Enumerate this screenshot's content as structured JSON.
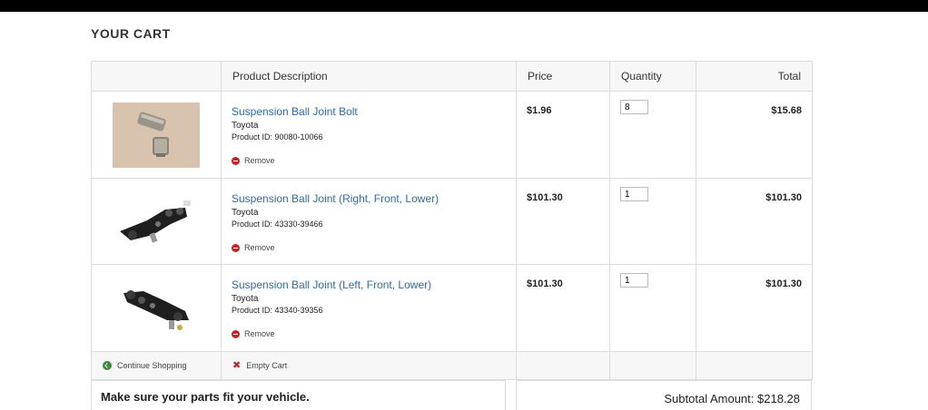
{
  "cart": {
    "title": "YOUR CART",
    "headers": {
      "description": "Product Description",
      "price": "Price",
      "quantity": "Quantity",
      "total": "Total"
    },
    "items": [
      {
        "name": "Suspension Ball Joint Bolt",
        "brand": "Toyota",
        "product_id": "Product ID: 90080-10066",
        "price": "$1.96",
        "quantity": "8",
        "total": "$15.68",
        "remove_label": "Remove"
      },
      {
        "name": "Suspension Ball Joint (Right, Front, Lower)",
        "brand": "Toyota",
        "product_id": "Product ID: 43330-39466",
        "price": "$101.30",
        "quantity": "1",
        "total": "$101.30",
        "remove_label": "Remove"
      },
      {
        "name": "Suspension Ball Joint (Left, Front, Lower)",
        "brand": "Toyota",
        "product_id": "Product ID: 43340-39356",
        "price": "$101.30",
        "quantity": "1",
        "total": "$101.30",
        "remove_label": "Remove"
      }
    ],
    "footer": {
      "continue_label": "Continue Shopping",
      "empty_label": "Empty Cart"
    },
    "fit_message": "Make sure your parts fit your vehicle.",
    "subtotal": "Subtotal Amount: $218.28"
  },
  "colors": {
    "link": "#2b6cb0",
    "remove": "#cc2222",
    "continue": "#3a8a3a",
    "header_bg": "#f7f7f7",
    "border": "#dcdcdc"
  },
  "icons": {
    "remove": "remove-circle-icon",
    "continue": "back-arrow-circle-icon",
    "empty": "x-icon"
  }
}
